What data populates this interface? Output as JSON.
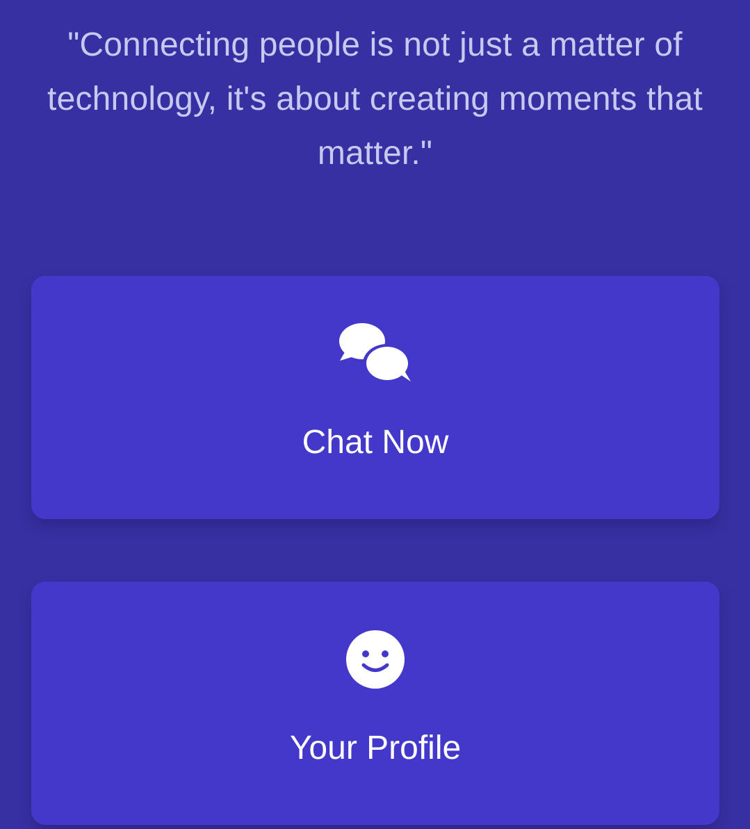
{
  "quote": {
    "text": "\"Connecting people is not just a matter of technology, it's about creating moments that matter.\""
  },
  "actions": [
    {
      "label": "Chat Now",
      "icon": "chat-bubbles-icon"
    },
    {
      "label": "Your Profile",
      "icon": "smiley-face-icon"
    }
  ],
  "colors": {
    "background": "#3730a3",
    "card": "#4338ca",
    "quote_text": "#c7c9f0",
    "label_text": "#ffffff"
  }
}
